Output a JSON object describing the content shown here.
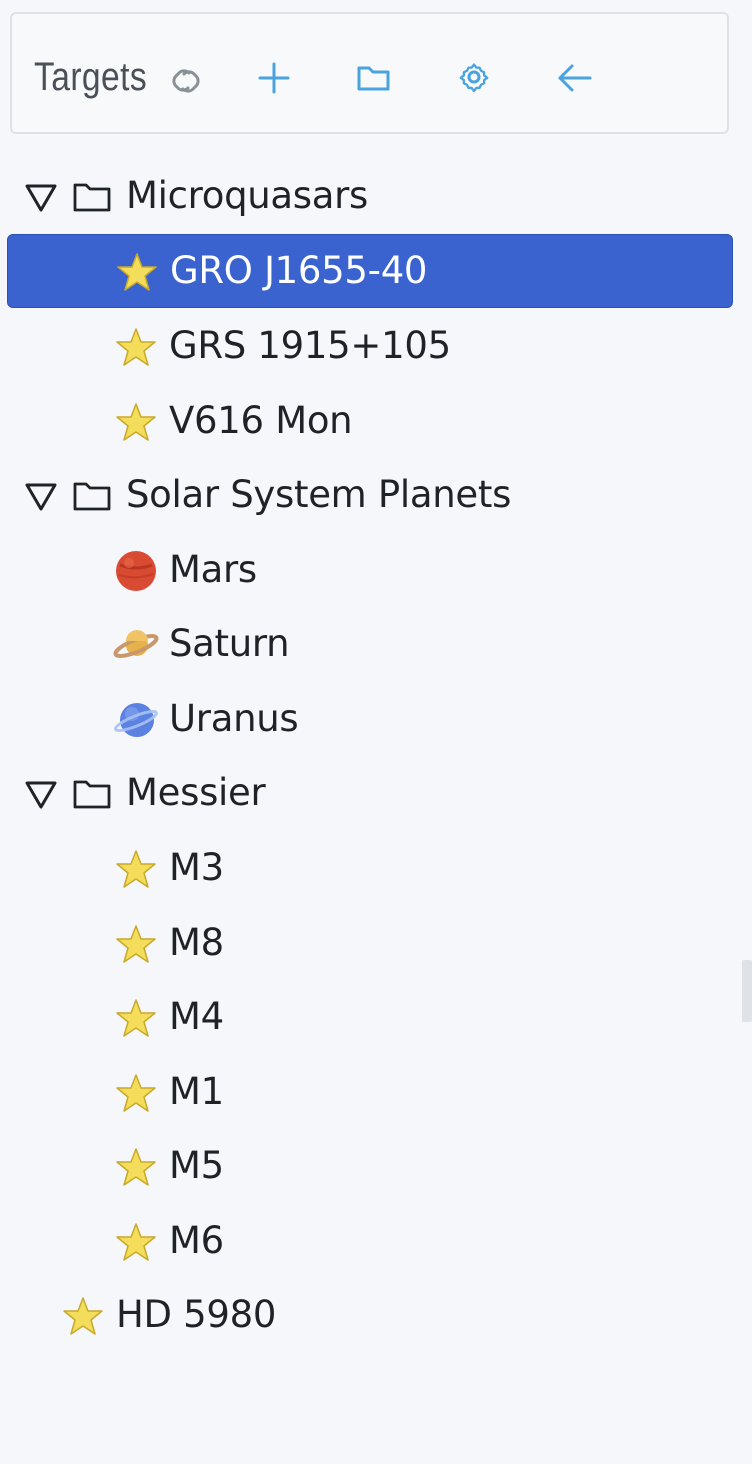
{
  "toolbar": {
    "title": "Targets",
    "icons": [
      "link-icon",
      "plus-icon",
      "folder-icon",
      "gear-icon",
      "arrow-left-icon"
    ]
  },
  "colors": {
    "accent": "#4aa3df",
    "selected": "#3a63d0",
    "star": "#f0d64a"
  },
  "tree": {
    "groups": [
      {
        "label": "Microquasars",
        "expanded": true,
        "items": [
          {
            "label": "GRO J1655-40",
            "icon": "star-icon",
            "selected": true
          },
          {
            "label": "GRS 1915+105",
            "icon": "star-icon"
          },
          {
            "label": "V616 Mon",
            "icon": "star-icon"
          }
        ]
      },
      {
        "label": "Solar System Planets",
        "expanded": true,
        "items": [
          {
            "label": "Mars",
            "icon": "mars-icon"
          },
          {
            "label": "Saturn",
            "icon": "saturn-icon"
          },
          {
            "label": "Uranus",
            "icon": "uranus-icon"
          }
        ]
      },
      {
        "label": "Messier",
        "expanded": true,
        "items": [
          {
            "label": "M3",
            "icon": "star-icon"
          },
          {
            "label": "M8",
            "icon": "star-icon"
          },
          {
            "label": "M4",
            "icon": "star-icon"
          },
          {
            "label": "M1",
            "icon": "star-icon"
          },
          {
            "label": "M5",
            "icon": "star-icon"
          },
          {
            "label": "M6",
            "icon": "star-icon"
          }
        ]
      }
    ],
    "root_items": [
      {
        "label": "HD 5980",
        "icon": "star-icon"
      }
    ]
  }
}
